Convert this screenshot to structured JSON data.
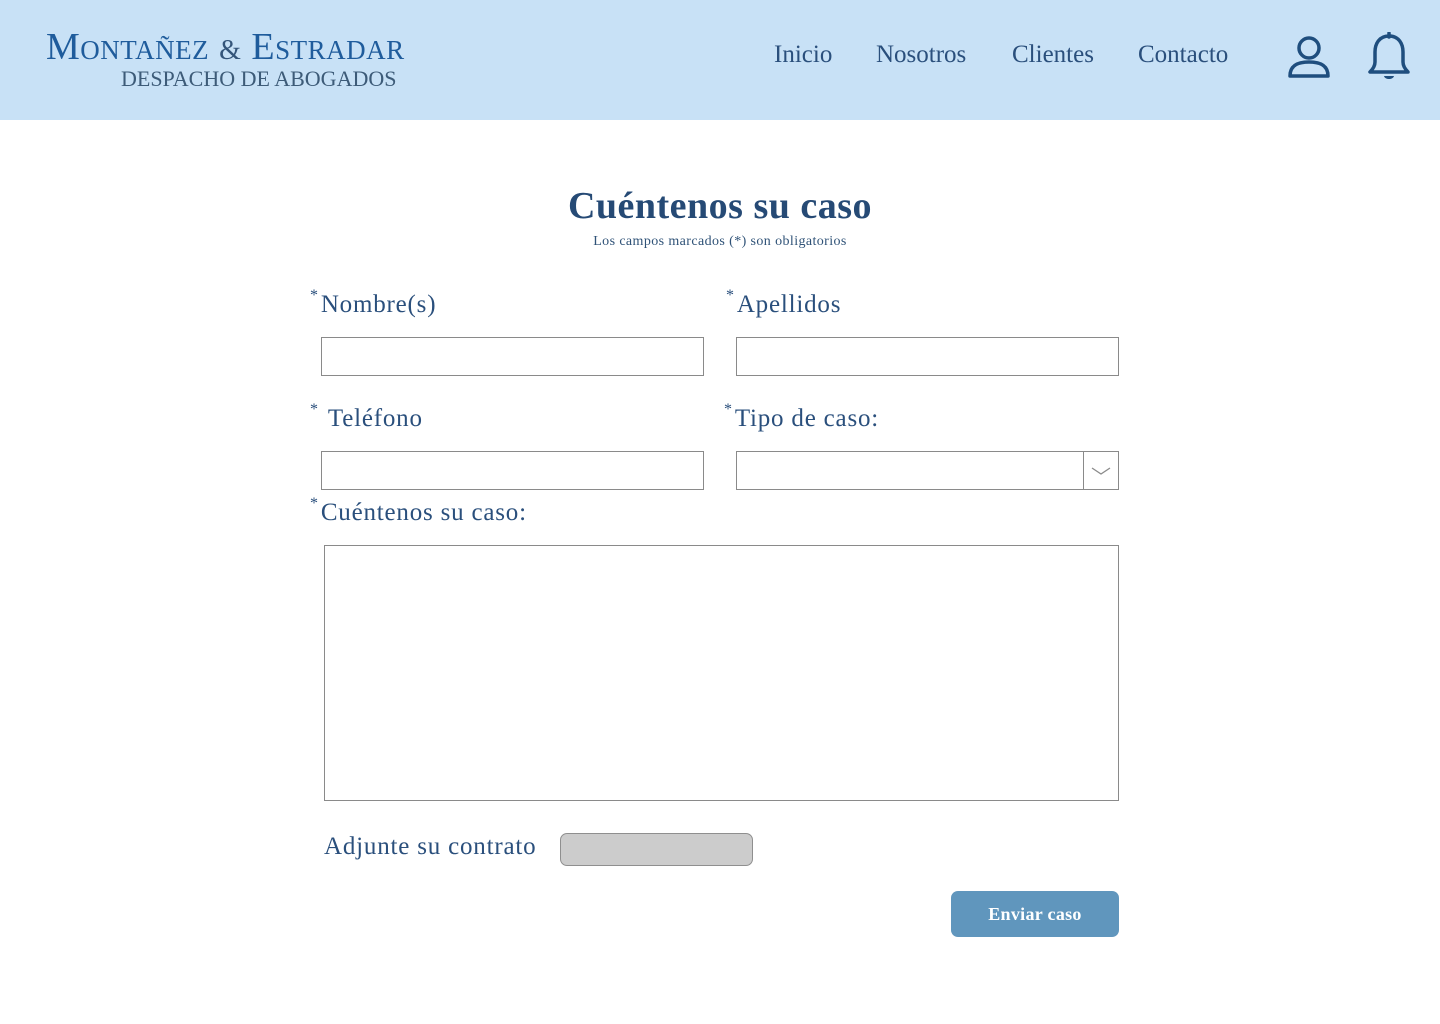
{
  "header": {
    "brand_name_1": "Montañez",
    "brand_amp": "&",
    "brand_name_2": "Estradar",
    "brand_subtitle": "DESPACHO DE ABOGADOS",
    "nav": [
      "Inicio",
      "Nosotros",
      "Clientes",
      "Contacto"
    ],
    "icons": [
      "user-icon",
      "bell-icon"
    ]
  },
  "form": {
    "title": "Cuéntenos su caso",
    "subtitle": "Los campos marcados (*) son obligatorios",
    "required_mark": "*",
    "fields": {
      "nombre_label": "Nombre(s)",
      "nombre_value": "",
      "apellidos_label": "Apellidos",
      "apellidos_value": "",
      "telefono_label": "Teléfono",
      "telefono_value": "",
      "tipo_caso_label": "Tipo de caso:",
      "tipo_caso_value": "",
      "caso_label": "Cuéntenos su caso:",
      "caso_value": ""
    },
    "attach_label": "Adjunte su contrato",
    "submit_label": "Enviar caso"
  },
  "colors": {
    "header_bg": "#c8e1f6",
    "primary_text": "#2a4f7c",
    "brand": "#1f5c9c",
    "submit_bg": "#6096bd",
    "file_button_bg": "#cccccc"
  }
}
